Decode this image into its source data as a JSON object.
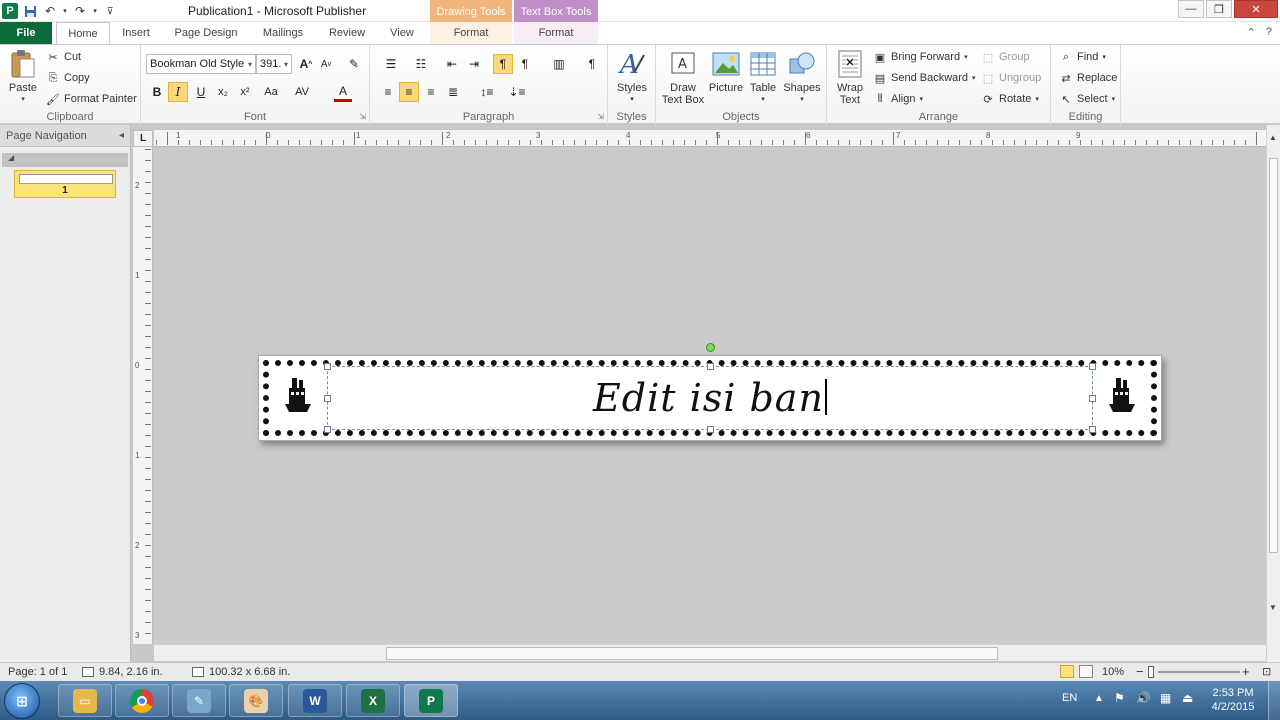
{
  "window": {
    "title": "Publication1 - Microsoft Publisher",
    "context_drawing": "Drawing Tools",
    "context_textbox": "Text Box Tools",
    "app_icon": "P"
  },
  "tabs": [
    {
      "label": "File"
    },
    {
      "label": "Home"
    },
    {
      "label": "Insert"
    },
    {
      "label": "Page Design"
    },
    {
      "label": "Mailings"
    },
    {
      "label": "Review"
    },
    {
      "label": "View"
    },
    {
      "label": "Format"
    },
    {
      "label": "Format"
    }
  ],
  "ribbon": {
    "clipboard": {
      "label": "Clipboard",
      "paste": "Paste",
      "cut": "Cut",
      "copy": "Copy",
      "format_painter": "Format Painter"
    },
    "font": {
      "label": "Font",
      "font_name": "Bookman Old Style",
      "font_size": "391.",
      "bold": "B",
      "italic": "I",
      "underline": "U",
      "subscript": "x₂",
      "superscript": "x²",
      "change_case": "Aa",
      "font_color": "A"
    },
    "paragraph": {
      "label": "Paragraph"
    },
    "styles": {
      "label": "Styles",
      "button": "Styles"
    },
    "objects": {
      "label": "Objects",
      "draw_text_box_1": "Draw",
      "draw_text_box_2": "Text Box",
      "picture": "Picture",
      "table": "Table",
      "shapes": "Shapes"
    },
    "arrange": {
      "label": "Arrange",
      "wrap_text_1": "Wrap",
      "wrap_text_2": "Text",
      "bring_forward": "Bring Forward",
      "send_backward": "Send Backward",
      "align": "Align",
      "group": "Group",
      "ungroup": "Ungroup",
      "rotate": "Rotate"
    },
    "editing": {
      "label": "Editing",
      "find": "Find",
      "replace": "Replace",
      "select": "Select"
    }
  },
  "nav_pane": {
    "title": "Page Navigation",
    "page_number": "1"
  },
  "ruler_corner": "L",
  "ruler_h_numbers": [
    "1",
    "0",
    "1",
    "2",
    "3",
    "4",
    "5",
    "6",
    "7",
    "8",
    "9"
  ],
  "ruler_v_numbers": [
    "2",
    "1",
    "0",
    "1",
    "2",
    "3"
  ],
  "document": {
    "banner_text": "Edit isi ban"
  },
  "status": {
    "page": "Page: 1 of 1",
    "position": "9.84, 2.16 in.",
    "size": "100.32 x 6.68 in.",
    "zoom": "10%"
  },
  "taskbar": {
    "language": "EN",
    "time": "2:53 PM",
    "date": "4/2/2015"
  },
  "colors": {
    "file_tab": "#0b6b3a",
    "drawing_tools": "#f0b57c",
    "textbox_tools": "#c08fc8",
    "selection_highlight": "#fcd87a"
  }
}
